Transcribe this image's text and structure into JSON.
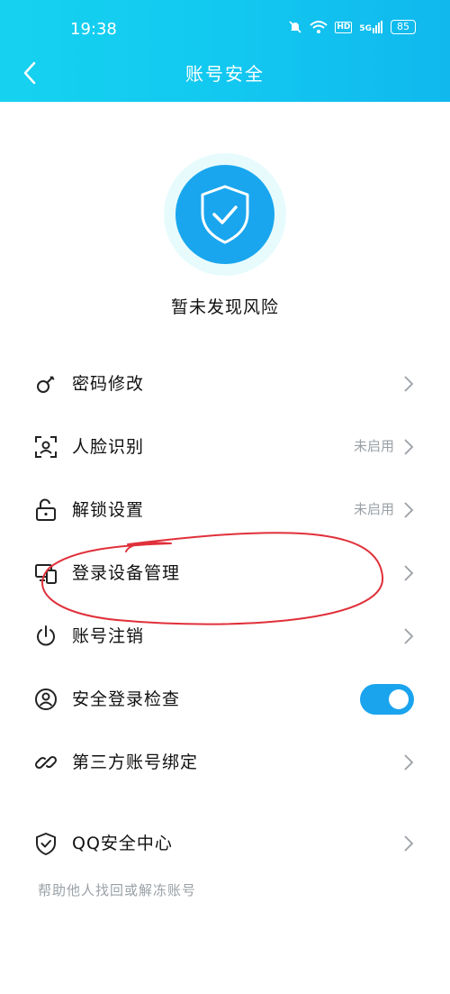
{
  "status_bar": {
    "time": "19:38",
    "network": "5G",
    "hd": "HD",
    "battery": "85"
  },
  "header": {
    "title": "账号安全"
  },
  "security_status": {
    "text": "暂未发现风险"
  },
  "menu": {
    "items": [
      {
        "label": "密码修改",
        "value": "",
        "icon": "key-icon"
      },
      {
        "label": "人脸识别",
        "value": "未启用",
        "icon": "face-scan-icon"
      },
      {
        "label": "解锁设置",
        "value": "未启用",
        "icon": "unlock-icon"
      },
      {
        "label": "登录设备管理",
        "value": "",
        "icon": "devices-icon"
      },
      {
        "label": "账号注销",
        "value": "",
        "icon": "power-icon"
      },
      {
        "label": "安全登录检查",
        "toggle_on": true,
        "icon": "user-circle-icon"
      },
      {
        "label": "第三方账号绑定",
        "value": "",
        "icon": "link-icon"
      },
      {
        "label": "QQ安全中心",
        "value": "",
        "icon": "shield-check-icon"
      }
    ]
  },
  "help_link": "帮助他人找回或解冻账号",
  "colors": {
    "header_start": "#16d2f0",
    "header_end": "#10b8ee",
    "accent": "#19a6ee",
    "annotation": "#e0303a"
  }
}
